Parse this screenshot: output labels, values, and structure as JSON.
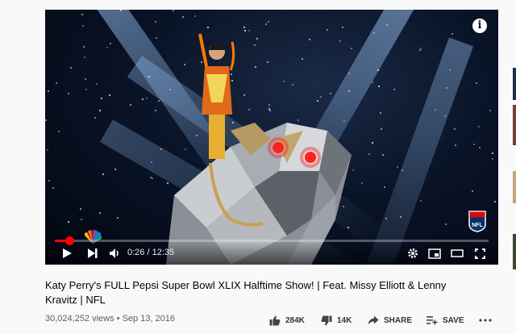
{
  "player": {
    "info_label": "i",
    "time_current": "0:26",
    "time_total": "12:35",
    "time_display": "0:26 / 12:35",
    "progress_fraction": 0.034
  },
  "video": {
    "title": "Katy Perry's FULL Pepsi Super Bowl XLIX Halftime Show! | Feat. Missy Elliott & Lenny Kravitz | NFL",
    "meta": "30,024,252 views • Sep 13, 2016"
  },
  "actions": {
    "like_count": "284K",
    "dislike_count": "14K",
    "share_label": "SHARE",
    "save_label": "SAVE"
  },
  "colors": {
    "accent": "#ff0000",
    "background": "#f9f9f9"
  }
}
